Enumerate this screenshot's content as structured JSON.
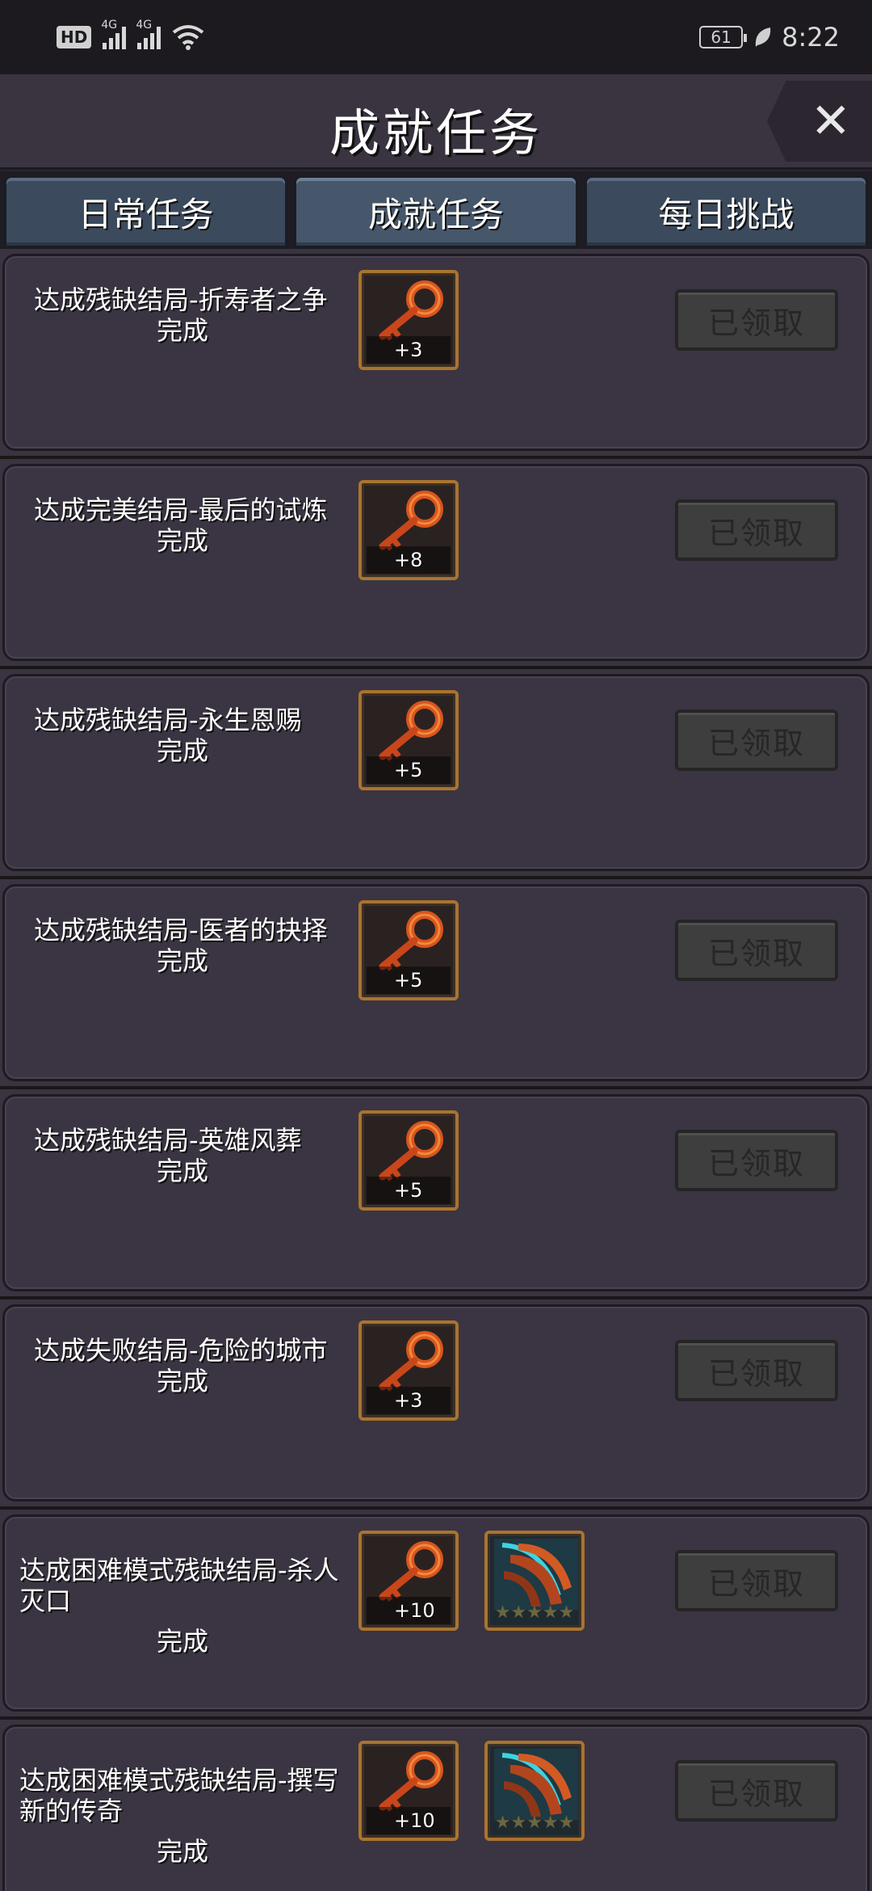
{
  "statusbar": {
    "hd_label": "HD",
    "sim1_label": "4G",
    "sim2_label": "4G",
    "battery": "61",
    "time": "8:22"
  },
  "header": {
    "title": "成就任务",
    "close_label": "✕"
  },
  "tabs": [
    {
      "label": "日常任务",
      "active": false
    },
    {
      "label": "成就任务",
      "active": true
    },
    {
      "label": "每日挑战",
      "active": false
    }
  ],
  "tasks": [
    {
      "desc": "达成残缺结局-折寿者之争",
      "status": "完成",
      "key_count": "+3",
      "button": "已领取"
    },
    {
      "desc": "达成完美结局-最后的试炼",
      "status": "完成",
      "key_count": "+8",
      "button": "已领取"
    },
    {
      "desc": "达成残缺结局-永生恩赐",
      "status": "完成",
      "key_count": "+5",
      "button": "已领取"
    },
    {
      "desc": "达成残缺结局-医者的抉择",
      "status": "完成",
      "key_count": "+5",
      "button": "已领取"
    },
    {
      "desc": "达成残缺结局-英雄风葬",
      "status": "完成",
      "key_count": "+5",
      "button": "已领取"
    },
    {
      "desc": "达成失败结局-危险的城市",
      "status": "完成",
      "key_count": "+3",
      "button": "已领取"
    },
    {
      "desc": "达成困难模式残缺结局-杀人灭口",
      "status": "完成",
      "key_count": "+10",
      "button": "已领取",
      "weapon_stars": "★★★★★"
    },
    {
      "desc": "达成困难模式残缺结局-撰写新的传奇",
      "status": "完成",
      "key_count": "+10",
      "button": "已领取",
      "weapon_stars": "★★★★★"
    }
  ],
  "colors": {
    "panel_bg": "#3b3442",
    "tab_bg": "#3b4a5c",
    "reward_border": "#a8742f",
    "button_disabled": "#3e3e3e"
  },
  "icons": {
    "key": "key-icon",
    "weapon": "claw-weapon-icon",
    "close": "close-icon"
  }
}
